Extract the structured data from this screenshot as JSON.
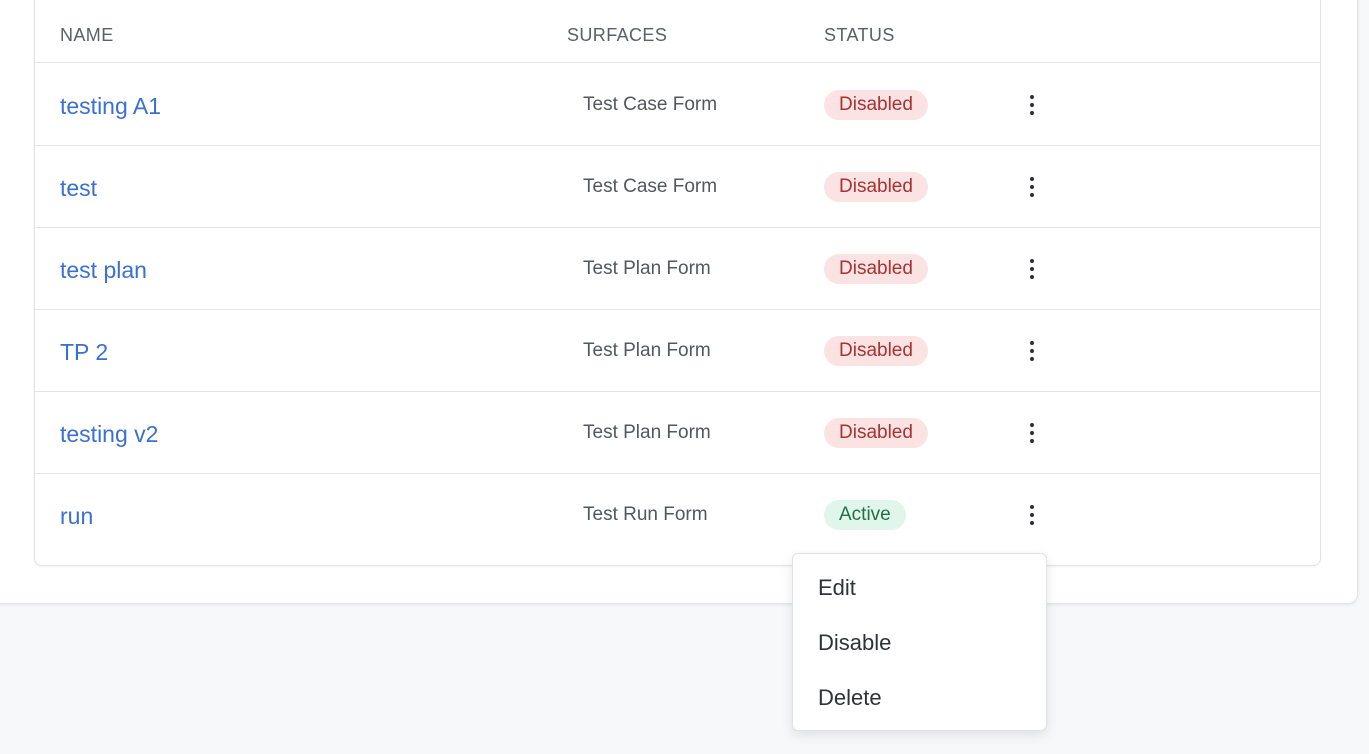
{
  "table": {
    "headers": {
      "name": "NAME",
      "surfaces": "SURFACES",
      "status": "STATUS"
    },
    "rows": [
      {
        "name": "testing A1",
        "surface": "Test Case Form",
        "status": "Disabled"
      },
      {
        "name": "test",
        "surface": "Test Case Form",
        "status": "Disabled"
      },
      {
        "name": "test plan",
        "surface": "Test Plan Form",
        "status": "Disabled"
      },
      {
        "name": "TP 2",
        "surface": "Test Plan Form",
        "status": "Disabled"
      },
      {
        "name": "testing v2",
        "surface": "Test Plan Form",
        "status": "Disabled"
      },
      {
        "name": "run",
        "surface": "Test Run Form",
        "status": "Active"
      }
    ]
  },
  "row_menu": {
    "items": [
      "Edit",
      "Disable",
      "Delete"
    ]
  },
  "icons": {
    "row_actions": "kebab-menu-icon"
  },
  "colors": {
    "link": "#3b6fd1",
    "disabled_badge_bg": "#fbe3e3",
    "disabled_badge_text": "#a83232",
    "active_badge_bg": "#e0f6ea",
    "active_badge_text": "#22704a"
  }
}
